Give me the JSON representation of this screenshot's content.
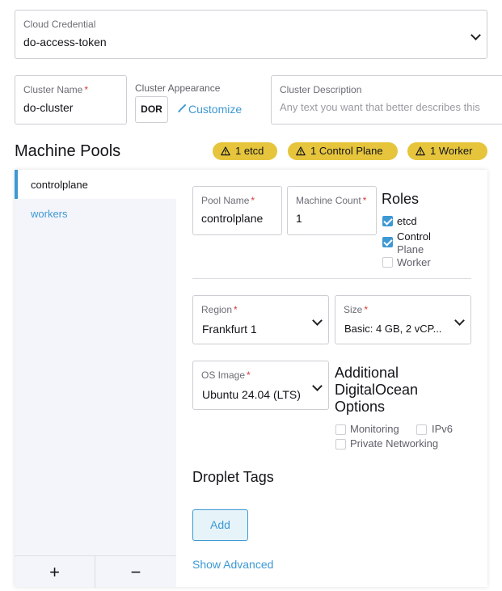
{
  "cloud_credential": {
    "label": "Cloud Credential",
    "value": "do-access-token"
  },
  "cluster_name": {
    "label": "Cluster Name",
    "required_mark": "*",
    "value": "do-cluster"
  },
  "cluster_appearance": {
    "label": "Cluster Appearance",
    "avatar_text": "DOR",
    "customize_label": "Customize"
  },
  "cluster_description": {
    "label": "Cluster Description",
    "placeholder": "Any text you want that better describes this"
  },
  "machine_pools": {
    "title": "Machine Pools",
    "badges": [
      "1 etcd",
      "1 Control Plane",
      "1 Worker"
    ],
    "pools": [
      {
        "name": "controlplane",
        "active": true
      },
      {
        "name": "workers",
        "active": false
      }
    ],
    "add_symbol": "+",
    "remove_symbol": "−"
  },
  "pool_form": {
    "pool_name": {
      "label": "Pool Name",
      "required_mark": "*",
      "value": "controlplane"
    },
    "machine_count": {
      "label": "Machine Count",
      "required_mark": "*",
      "value": "1"
    },
    "roles": {
      "title": "Roles",
      "etcd": {
        "label": "etcd",
        "checked": true
      },
      "control_plane": {
        "label_line1": "Control",
        "label_line2": "Plane",
        "checked": true
      },
      "worker": {
        "label": "Worker",
        "checked": false
      }
    },
    "region": {
      "label": "Region",
      "required_mark": "*",
      "value": "Frankfurt 1"
    },
    "size": {
      "label": "Size",
      "required_mark": "*",
      "value": "Basic: 4 GB, 2 vCP..."
    },
    "os_image": {
      "label": "OS Image",
      "required_mark": "*",
      "value": "Ubuntu 24.04 (LTS)"
    },
    "additional_options": {
      "title_line1": "Additional",
      "title_line2": "DigitalOcean",
      "title_line3": "Options",
      "monitoring": {
        "label": "Monitoring",
        "checked": false
      },
      "ipv6": {
        "label": "IPv6",
        "checked": false
      },
      "private_networking": {
        "label": "Private Networking",
        "checked": false
      }
    },
    "droplet_tags": {
      "title": "Droplet Tags",
      "add_label": "Add"
    },
    "show_advanced": "Show Advanced"
  },
  "colors": {
    "accent": "#3d98d3",
    "badge_warning": "#e6c53c",
    "required": "#d63a3a"
  },
  "icons": {
    "dropdown": "chevron-down-icon",
    "warning": "warning-triangle-icon",
    "customize": "paintbrush-icon"
  }
}
